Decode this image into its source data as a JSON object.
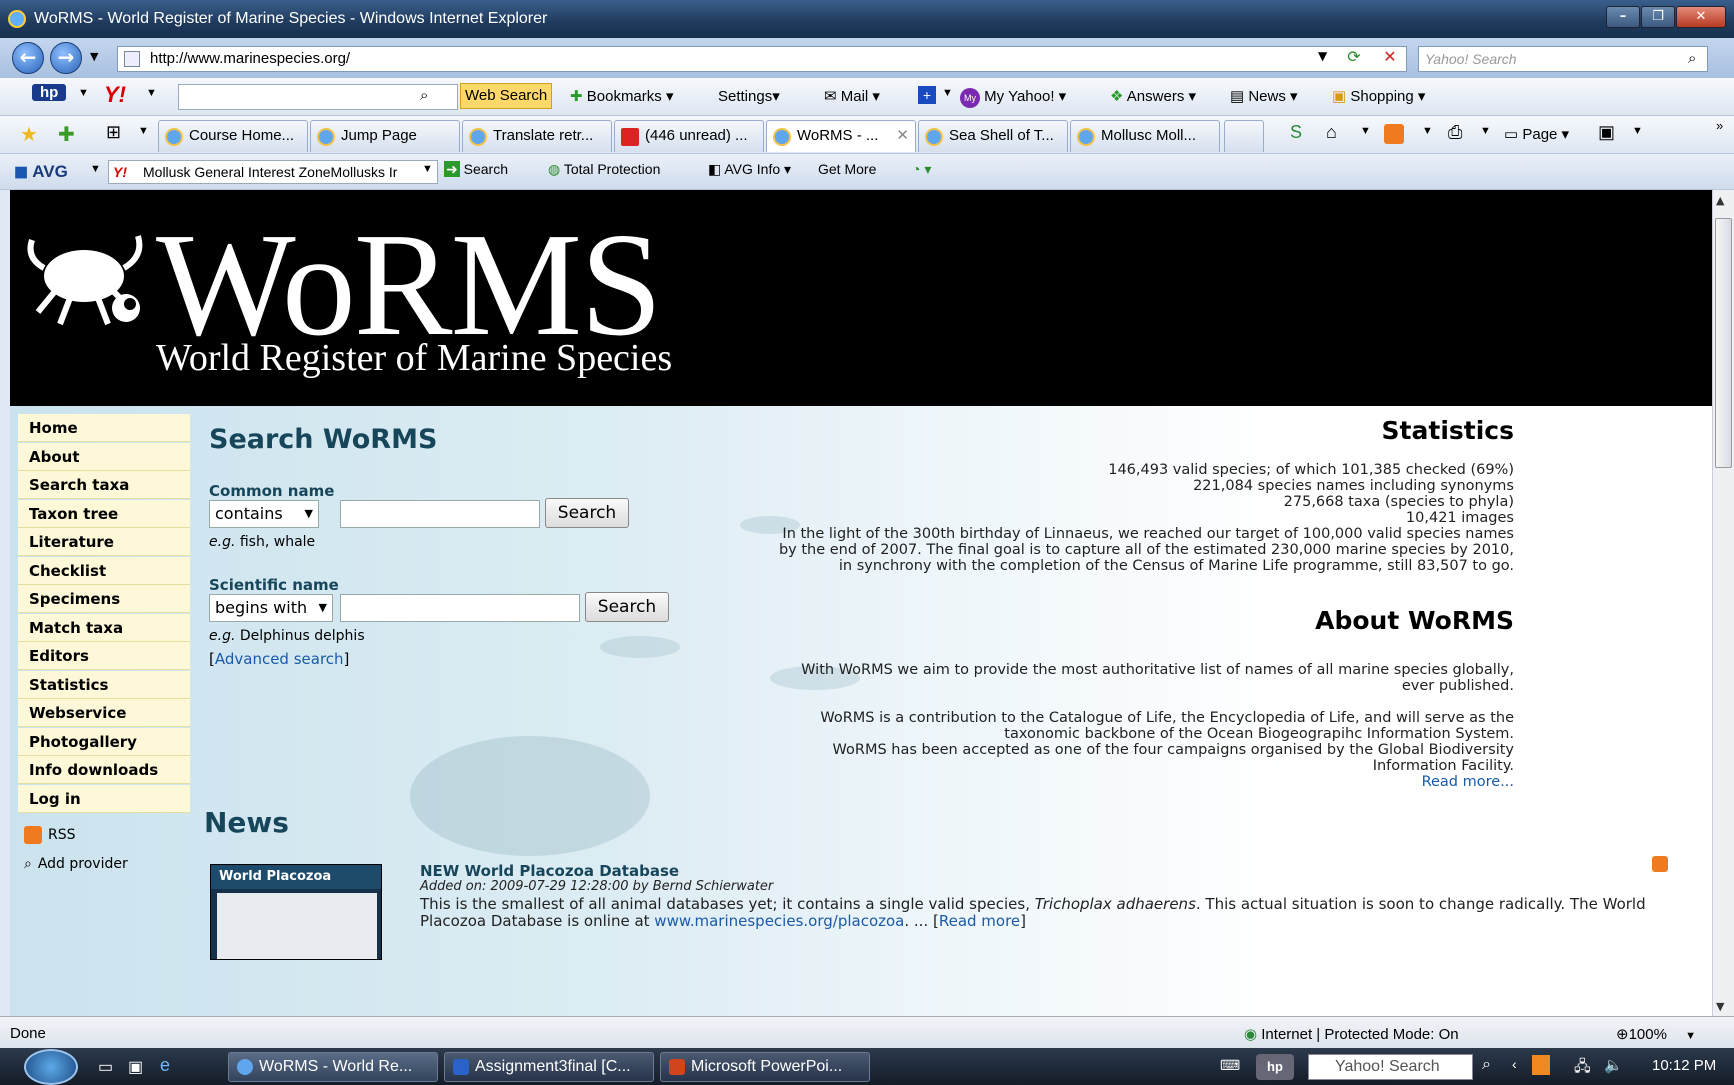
{
  "window": {
    "title": "WoRMS - World Register of Marine Species - Windows Internet Explorer"
  },
  "address": {
    "url": "http://www.marinespecies.org/",
    "search_placeholder": "Yahoo! Search"
  },
  "yahoo_toolbar": {
    "web_search": "Web Search",
    "bookmarks": "Bookmarks",
    "settings": "Settings",
    "mail": "Mail",
    "my_yahoo": "My Yahoo!",
    "answers": "Answers",
    "news": "News",
    "shopping": "Shopping"
  },
  "tabs": [
    {
      "label": "Course Home..."
    },
    {
      "label": "Jump Page"
    },
    {
      "label": "Translate retr..."
    },
    {
      "label": "(446 unread) ..."
    },
    {
      "label": "WoRMS - ..."
    },
    {
      "label": "Sea Shell of T..."
    },
    {
      "label": "Mollusc Moll..."
    }
  ],
  "ie_commands": {
    "page": "Page"
  },
  "avg_toolbar": {
    "avg": "AVG",
    "search_value": "Mollusk General  Interest ZoneMollusks Ir",
    "search": "Search",
    "total_protection": "Total Protection",
    "avg_info": "AVG Info",
    "get_more": "Get More"
  },
  "site": {
    "logo_title": "WoRMS",
    "logo_subtitle": "World Register of Marine Species",
    "nav": [
      "Home",
      "About",
      "Search taxa",
      "Taxon tree",
      "Literature",
      "Checklist",
      "Specimens",
      "Match taxa",
      "Editors",
      "Statistics",
      "Webservice",
      "Photogallery",
      "Info downloads",
      "Log in"
    ],
    "rss": "RSS",
    "add_provider": "Add provider",
    "search": {
      "title": "Search WoRMS",
      "common_label": "Common name",
      "common_mode": "contains",
      "common_value": "",
      "common_example_prefix": "e.g.",
      "common_example": " fish, whale",
      "scientific_label": "Scientific name",
      "scientific_mode": "begins with",
      "scientific_value": "",
      "scientific_example_prefix": "e.g.",
      "scientific_example": " Delphinus delphis",
      "button": "Search",
      "advanced_open": "[",
      "advanced": "Advanced search",
      "advanced_close": "]"
    },
    "statistics": {
      "title": "Statistics",
      "line1": "146,493 valid species; of which 101,385 checked (69%)",
      "line2": "221,084 species names including synonyms",
      "line3": "275,668 taxa (species to phyla)",
      "line4": "10,421 images",
      "paragraph": "In the light of the 300th birthday of Linnaeus, we reached our target of 100,000 valid species names by the end of 2007. The final goal is to capture all of the estimated 230,000 marine species by 2010, in synchrony with the completion of the Census of Marine Life programme, still 83,507 to go."
    },
    "about": {
      "title": "About WoRMS",
      "p1": "With WoRMS we aim to provide the most authoritative list of names of all marine species globally, ever published.",
      "p2": "WoRMS is a contribution to the Catalogue of Life, the Encyclopedia of Life, and will serve as the taxonomic backbone of the Ocean Biogeograpihc Information System.",
      "p3": "WoRMS has been accepted as one of the four campaigns organised by the Global Biodiversity Information Facility.",
      "read_more": "Read more..."
    },
    "news": {
      "title": "News",
      "thumb_title": "World Placozoa Database",
      "headline": "NEW World Placozoa Database",
      "meta": "Added on: 2009-07-29 12:28:00 by Bernd Schierwater",
      "body_a": "This is the smallest of all animal databases yet; it contains a single valid species, ",
      "body_species": "Trichoplax adhaerens",
      "body_b": ". This actual situation is soon to change radically. The World Placozoa Database is online at ",
      "body_link": "www.marinespecies.org/placozoa",
      "body_c": ". ...  [",
      "read_more": "Read more",
      "body_d": "]"
    }
  },
  "status": {
    "text": "Done",
    "zone": "Internet | Protected Mode: On",
    "zoom": "100%"
  },
  "taskbar": {
    "tasks": [
      "WoRMS - World Re...",
      "Assignment3final [C...",
      "Microsoft PowerPoi..."
    ],
    "search": "Yahoo! Search",
    "clock": "10:12 PM"
  }
}
